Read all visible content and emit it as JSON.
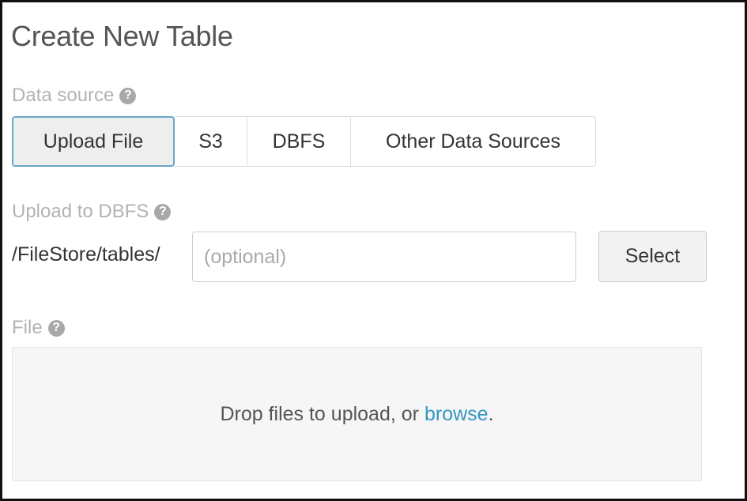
{
  "page": {
    "title": "Create New Table"
  },
  "data_source": {
    "label": "Data source",
    "help_icon": "?",
    "tabs": [
      {
        "label": "Upload File",
        "active": true
      },
      {
        "label": "S3",
        "active": false
      },
      {
        "label": "DBFS",
        "active": false
      },
      {
        "label": "Other Data Sources",
        "active": false
      }
    ]
  },
  "upload_to_dbfs": {
    "label": "Upload to DBFS",
    "help_icon": "?",
    "path_prefix": "/FileStore/tables/",
    "input_value": "",
    "input_placeholder": "(optional)",
    "select_label": "Select"
  },
  "file": {
    "label": "File",
    "help_icon": "?",
    "drop_text": "Drop files to upload, or",
    "browse_label": "browse",
    "drop_text_end": "."
  },
  "colors": {
    "accent_link": "#3497c0",
    "active_tab_border": "#6aa7c8",
    "label_gray": "#b3b3b3"
  }
}
